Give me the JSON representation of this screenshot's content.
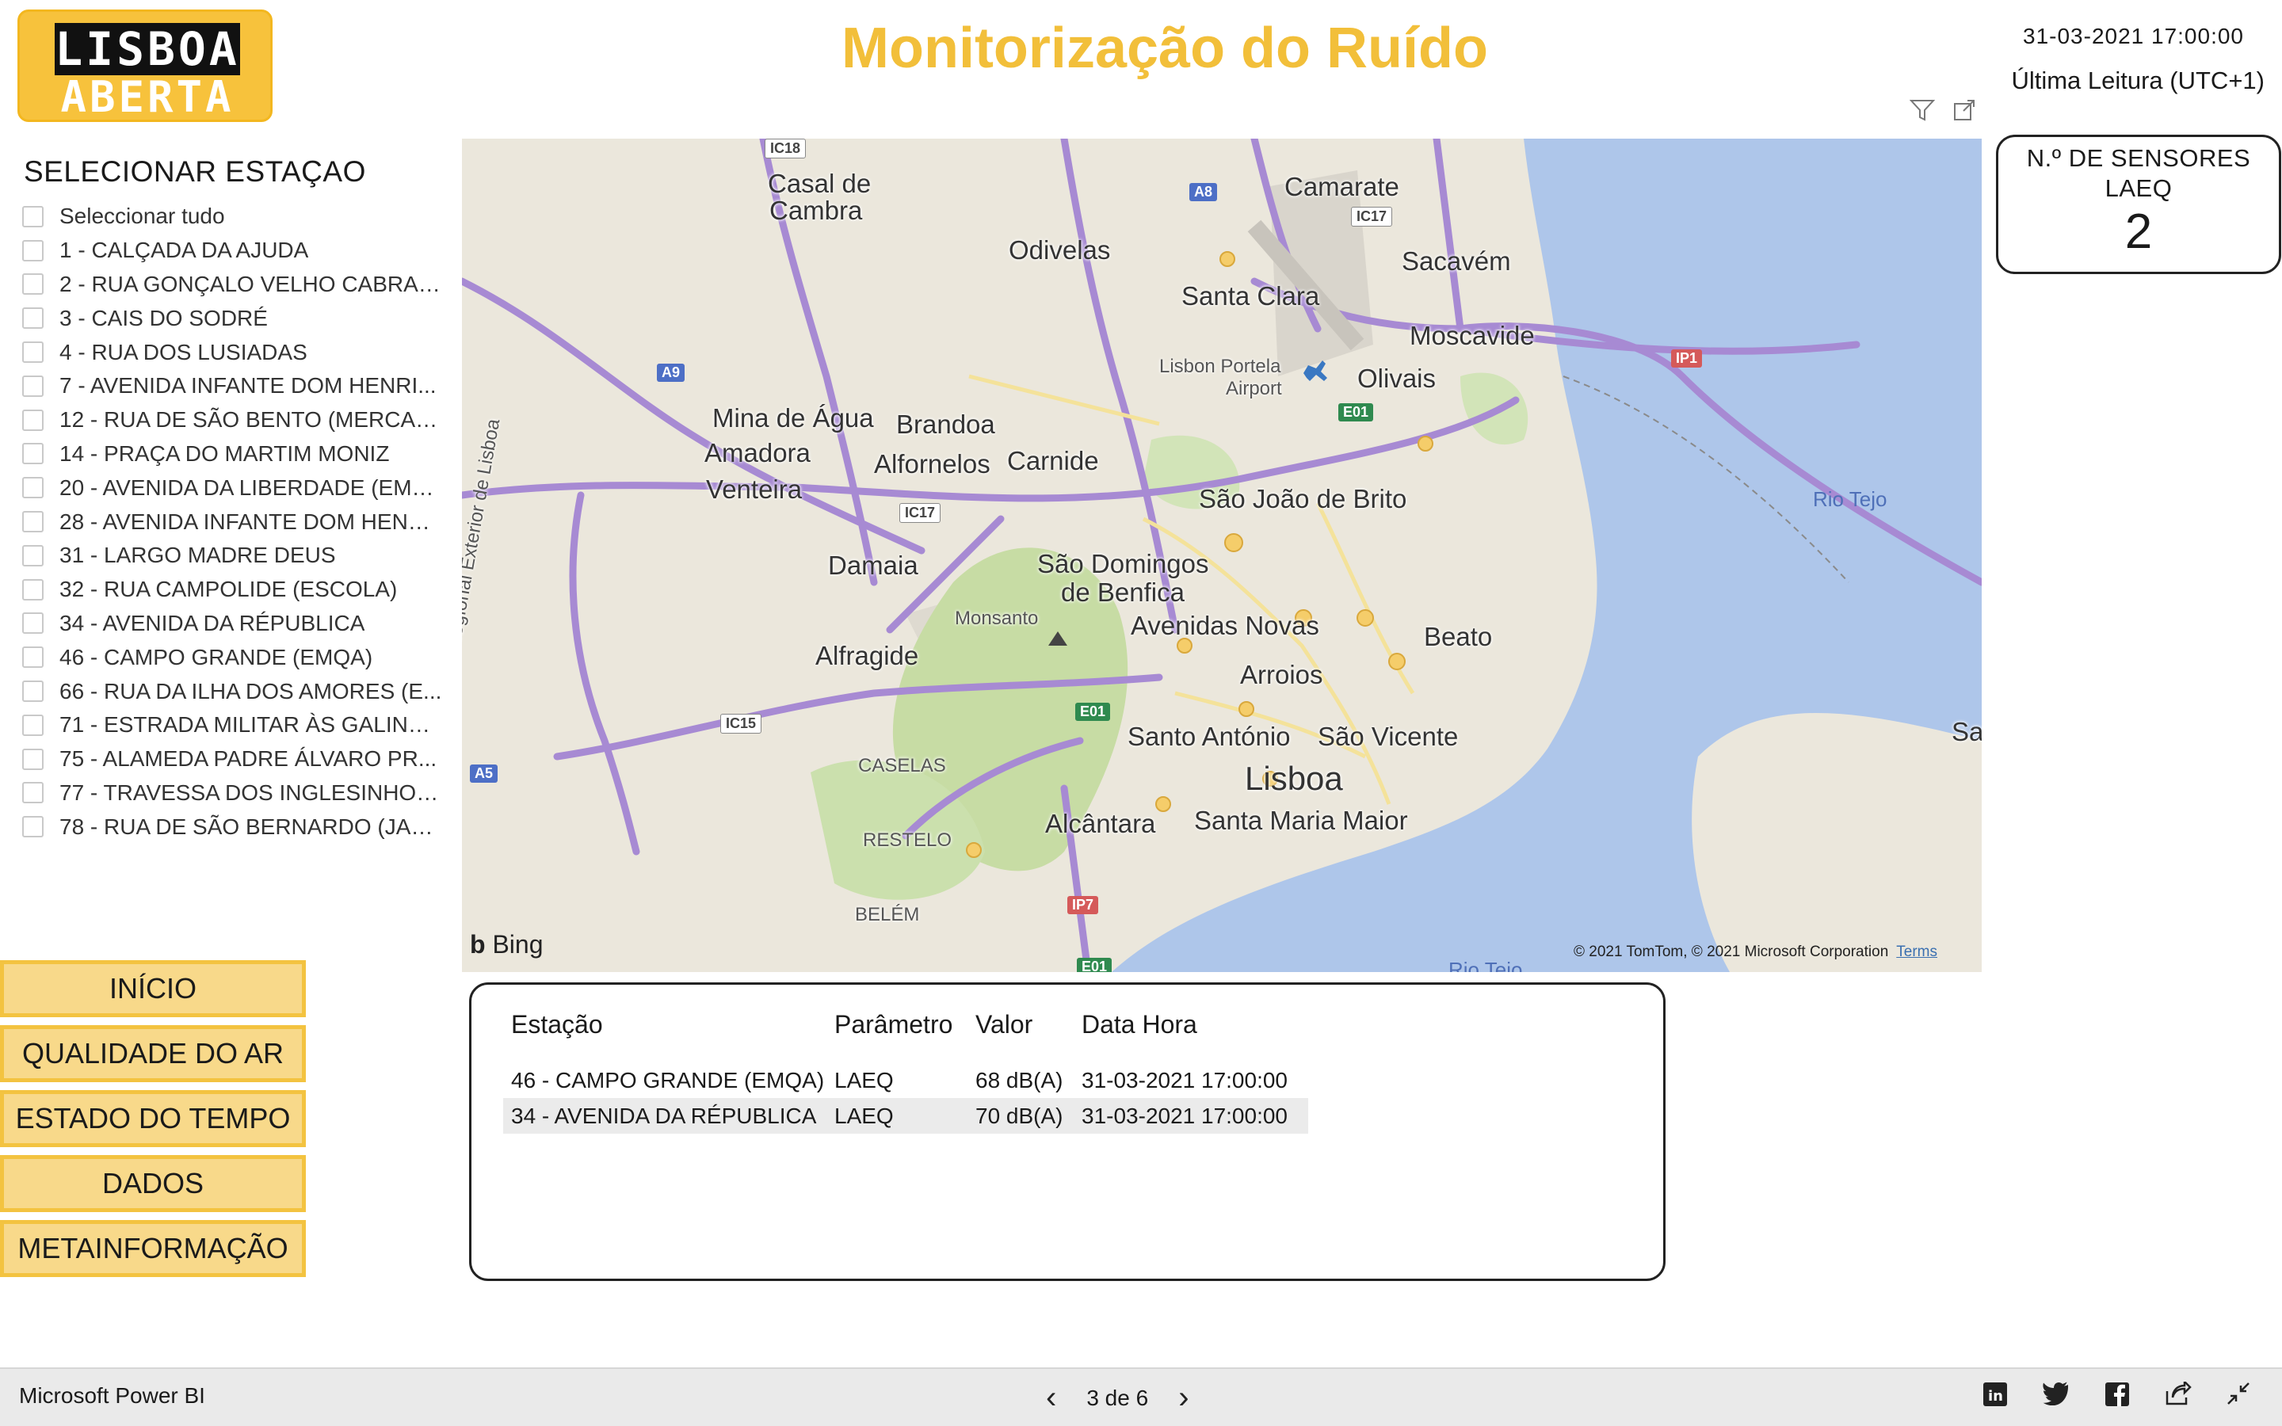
{
  "logo": {
    "line1": "LISBOA",
    "line2": "ABERTA"
  },
  "header": {
    "title": "Monitorização do Ruído",
    "datetime": "31-03-2021 17:00:00",
    "last_reading_label": "Última Leitura (UTC+1)"
  },
  "visual_header": {
    "filter_icon": "filter-icon",
    "focus_icon": "focus-mode-icon"
  },
  "slicer": {
    "title": "SELECIONAR ESTAÇAO",
    "items": [
      "Seleccionar tudo",
      "1 - CALÇADA DA AJUDA",
      "2 - RUA GONÇALO VELHO CABRAL...",
      "3 - CAIS DO SODRÉ",
      "4 - RUA DOS LUSIADAS",
      "7 - AVENIDA INFANTE DOM HENRI...",
      "12 - RUA DE SÃO BENTO (MERCAD...",
      "14 - PRAÇA DO MARTIM MONIZ",
      "20 - AVENIDA DA LIBERDADE (EMQ...",
      "28 - AVENIDA INFANTE DOM HENR...",
      "31 - LARGO MADRE DEUS",
      "32 - RUA CAMPOLIDE (ESCOLA)",
      "34 - AVENIDA DA RÉPUBLICA",
      "46 - CAMPO GRANDE (EMQA)",
      "66 - RUA DA ILHA DOS AMORES (E...",
      "71 - ESTRADA MILITAR ÀS GALINH...",
      "75 - ALAMEDA PADRE ÁLVARO PR...",
      "77 - TRAVESSA DOS INGLESINHOS ...",
      "78 - RUA DE SÃO BERNARDO (JAR..."
    ]
  },
  "nav": [
    "INÍCIO",
    "QUALIDADE DO AR",
    "ESTADO DO TEMPO",
    "DADOS",
    "METAINFORMAÇÃO"
  ],
  "map": {
    "places": {
      "casal_de_cambra_1": "Casal de",
      "casal_de_cambra_2": "Cambra",
      "camarate": "Camarate",
      "odivelas": "Odivelas",
      "sacavem": "Sacavém",
      "santa_clara": "Santa Clara",
      "moscavide": "Moscavide",
      "airport_1": "Lisbon Portela",
      "airport_2": "Airport",
      "olivais": "Olivais",
      "mina": "Mina de Água",
      "brandoa": "Brandoa",
      "amadora": "Amadora",
      "alfornelos": "Alfornelos",
      "carnide": "Carnide",
      "venteira": "Venteira",
      "sjbrito": "São João de Brito",
      "rio_tejo": "Rio Tejo",
      "damaia": "Damaia",
      "sdomingos_1": "São Domingos",
      "sdomingos_2": "de Benfica",
      "monsanto": "Monsanto",
      "avenidas": "Avenidas Novas",
      "beato": "Beato",
      "alfragide": "Alfragide",
      "arroios": "Arroios",
      "santo_antonio": "Santo António",
      "sao_vicente": "São Vicente",
      "sa": "Sa",
      "lisboa": "Lisboa",
      "casela": "CASELAS",
      "alcantara": "Alcântara",
      "santa_maria": "Santa Maria Maior",
      "restelo": "RESTELO",
      "belem": "BELÉM",
      "rio_tejo_2": "Rio Tejo",
      "circular": "Circular Regional Exterior de Lisboa"
    },
    "shields": {
      "ic18": "IC18",
      "a8": "A8",
      "ic17a": "IC17",
      "a9": "A9",
      "ip1": "IP1",
      "e01a": "E01",
      "ic17b": "IC17",
      "e01b": "E01",
      "ic15": "IC15",
      "a5": "A5",
      "ip7": "IP7",
      "e01c": "E01"
    },
    "bing": "Bing",
    "copyright": "© 2021 TomTom, © 2021 Microsoft Corporation",
    "terms": "Terms"
  },
  "sensor_card": {
    "title_line1": "N.º DE SENSORES",
    "title_line2": "LAEQ",
    "value": "2"
  },
  "table": {
    "headers": [
      "Estação",
      "Parâmetro",
      "Valor",
      "Data Hora"
    ],
    "rows": [
      [
        "46 - CAMPO GRANDE (EMQA)",
        "LAEQ",
        "68 dB(A)",
        "31-03-2021 17:00:00"
      ],
      [
        "34 - AVENIDA DA RÉPUBLICA",
        "LAEQ",
        "70 dB(A)",
        "31-03-2021 17:00:00"
      ]
    ]
  },
  "bottom_bar": {
    "brand": "Microsoft Power BI",
    "page_indicator": "3 de 6"
  },
  "colors": {
    "accent_yellow": "#f2bf3a",
    "button_fill": "#f8d98a",
    "water": "#aec6ea",
    "road_purple": "#a78ad3"
  }
}
